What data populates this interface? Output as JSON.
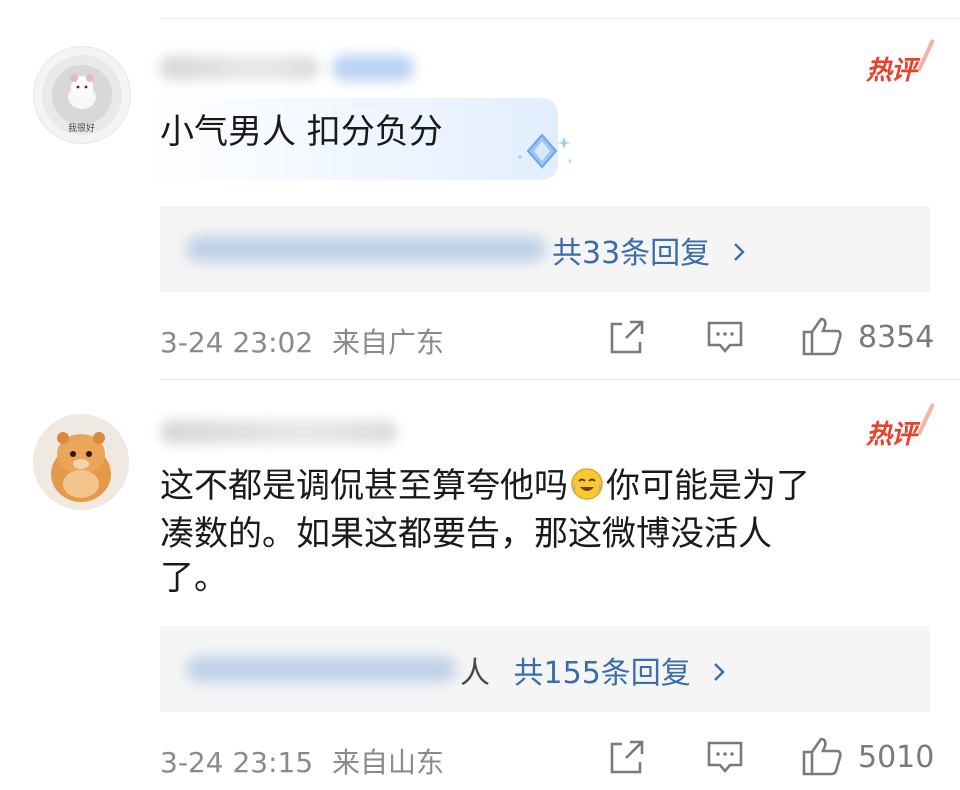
{
  "comments": [
    {
      "hot_tag": "热评",
      "text": "小气男人 扣分负分",
      "replies_label": "共33条回复",
      "reply_prefix": "",
      "time": "3-24 23:02",
      "location": "来自广东",
      "likes": "8354",
      "avatar_caption": "我很好"
    },
    {
      "hot_tag": "热评",
      "text_line1": "这不都是调侃甚至算夸他吗",
      "text_line1b": "你可能是为了",
      "text_line2": "凑数的。如果这都要告，那这微博没活人",
      "text_line3": "了。",
      "replies_label": "共155条回复",
      "reply_prefix": "人",
      "time": "3-24 23:15",
      "location": "来自山东",
      "likes": "5010"
    }
  ],
  "icons": {
    "share": "share-icon",
    "comment": "comment-icon",
    "like": "thumbs-up-icon",
    "chevron": "chevron-right-icon",
    "emoji": "crying-laughing-emoji-icon"
  },
  "colors": {
    "hot": "#e8412c",
    "link": "#3b6ea8",
    "meta": "#8a8a8a",
    "reply_bg": "#f5f5f5"
  }
}
